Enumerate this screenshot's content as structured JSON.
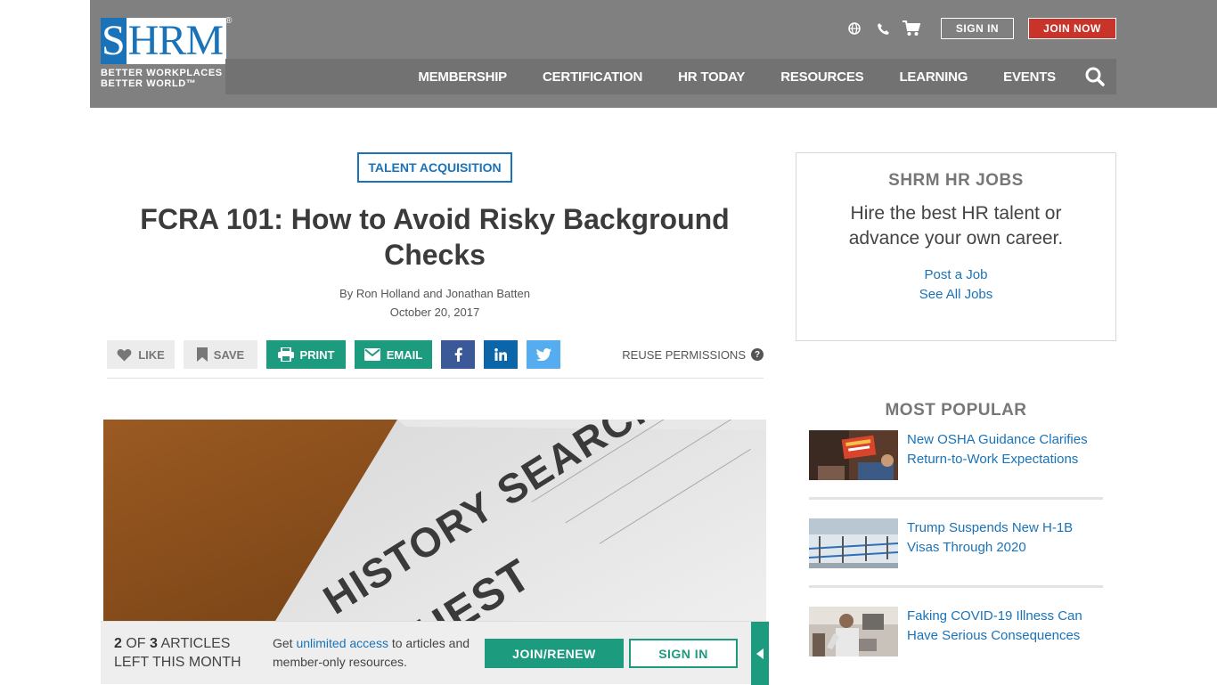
{
  "header": {
    "logo": {
      "letter_s": "S",
      "letters_rest": "HRM",
      "registered": "®",
      "tagline_1": "BETTER WORKPLACES",
      "tagline_2": "BETTER WORLD™"
    },
    "utility": {
      "globe_icon": "globe-icon",
      "phone_icon": "phone-icon",
      "cart_icon": "cart-icon",
      "sign_in": "SIGN IN",
      "join_now": "JOIN NOW"
    },
    "nav": [
      "MEMBERSHIP",
      "CERTIFICATION",
      "HR TODAY",
      "RESOURCES",
      "LEARNING",
      "EVENTS"
    ],
    "search_icon": "search-icon"
  },
  "article": {
    "category": "TALENT ACQUISITION",
    "title": "FCRA 101: How to Avoid Risky Background Checks",
    "byline": "By Ron Holland and Jonathan Batten",
    "date": "October 20, 2017",
    "share": {
      "like": "LIKE",
      "save": "SAVE",
      "print": "PRINT",
      "email": "EMAIL",
      "reuse": "REUSE PERMISSIONS",
      "reuse_help": "?"
    },
    "hero_text": {
      "line1": "HISTORY SEARCH",
      "line2": "QUEST"
    }
  },
  "paywall": {
    "count_num": "2",
    "count_of": "OF",
    "count_total": "3",
    "count_suffix": "ARTICLES",
    "count_line2": "LEFT THIS MONTH",
    "text_pre": "Get",
    "text_link": "unlimited access",
    "text_post": "to articles and member-only resources.",
    "join": "JOIN/RENEW",
    "sign_in": "SIGN IN"
  },
  "sidebar": {
    "jobs": {
      "title": "SHRM HR JOBS",
      "desc": "Hire the best HR talent or advance your own career.",
      "post": "Post a Job",
      "see_all": "See All Jobs"
    },
    "popular": {
      "title": "MOST POPULAR",
      "items": [
        {
          "text": "New OSHA Guidance Clarifies Return-to-Work Expectations"
        },
        {
          "text": "Trump Suspends New H-1B Visas Through 2020"
        },
        {
          "text": "Faking COVID-19 Illness Can Have Serious Consequences"
        }
      ]
    }
  },
  "colors": {
    "header_bg": "#808080",
    "nav_bg": "#727272",
    "brand_blue": "#1a73b8",
    "green": "#1d9b7f",
    "join_red": "#c8342a"
  }
}
